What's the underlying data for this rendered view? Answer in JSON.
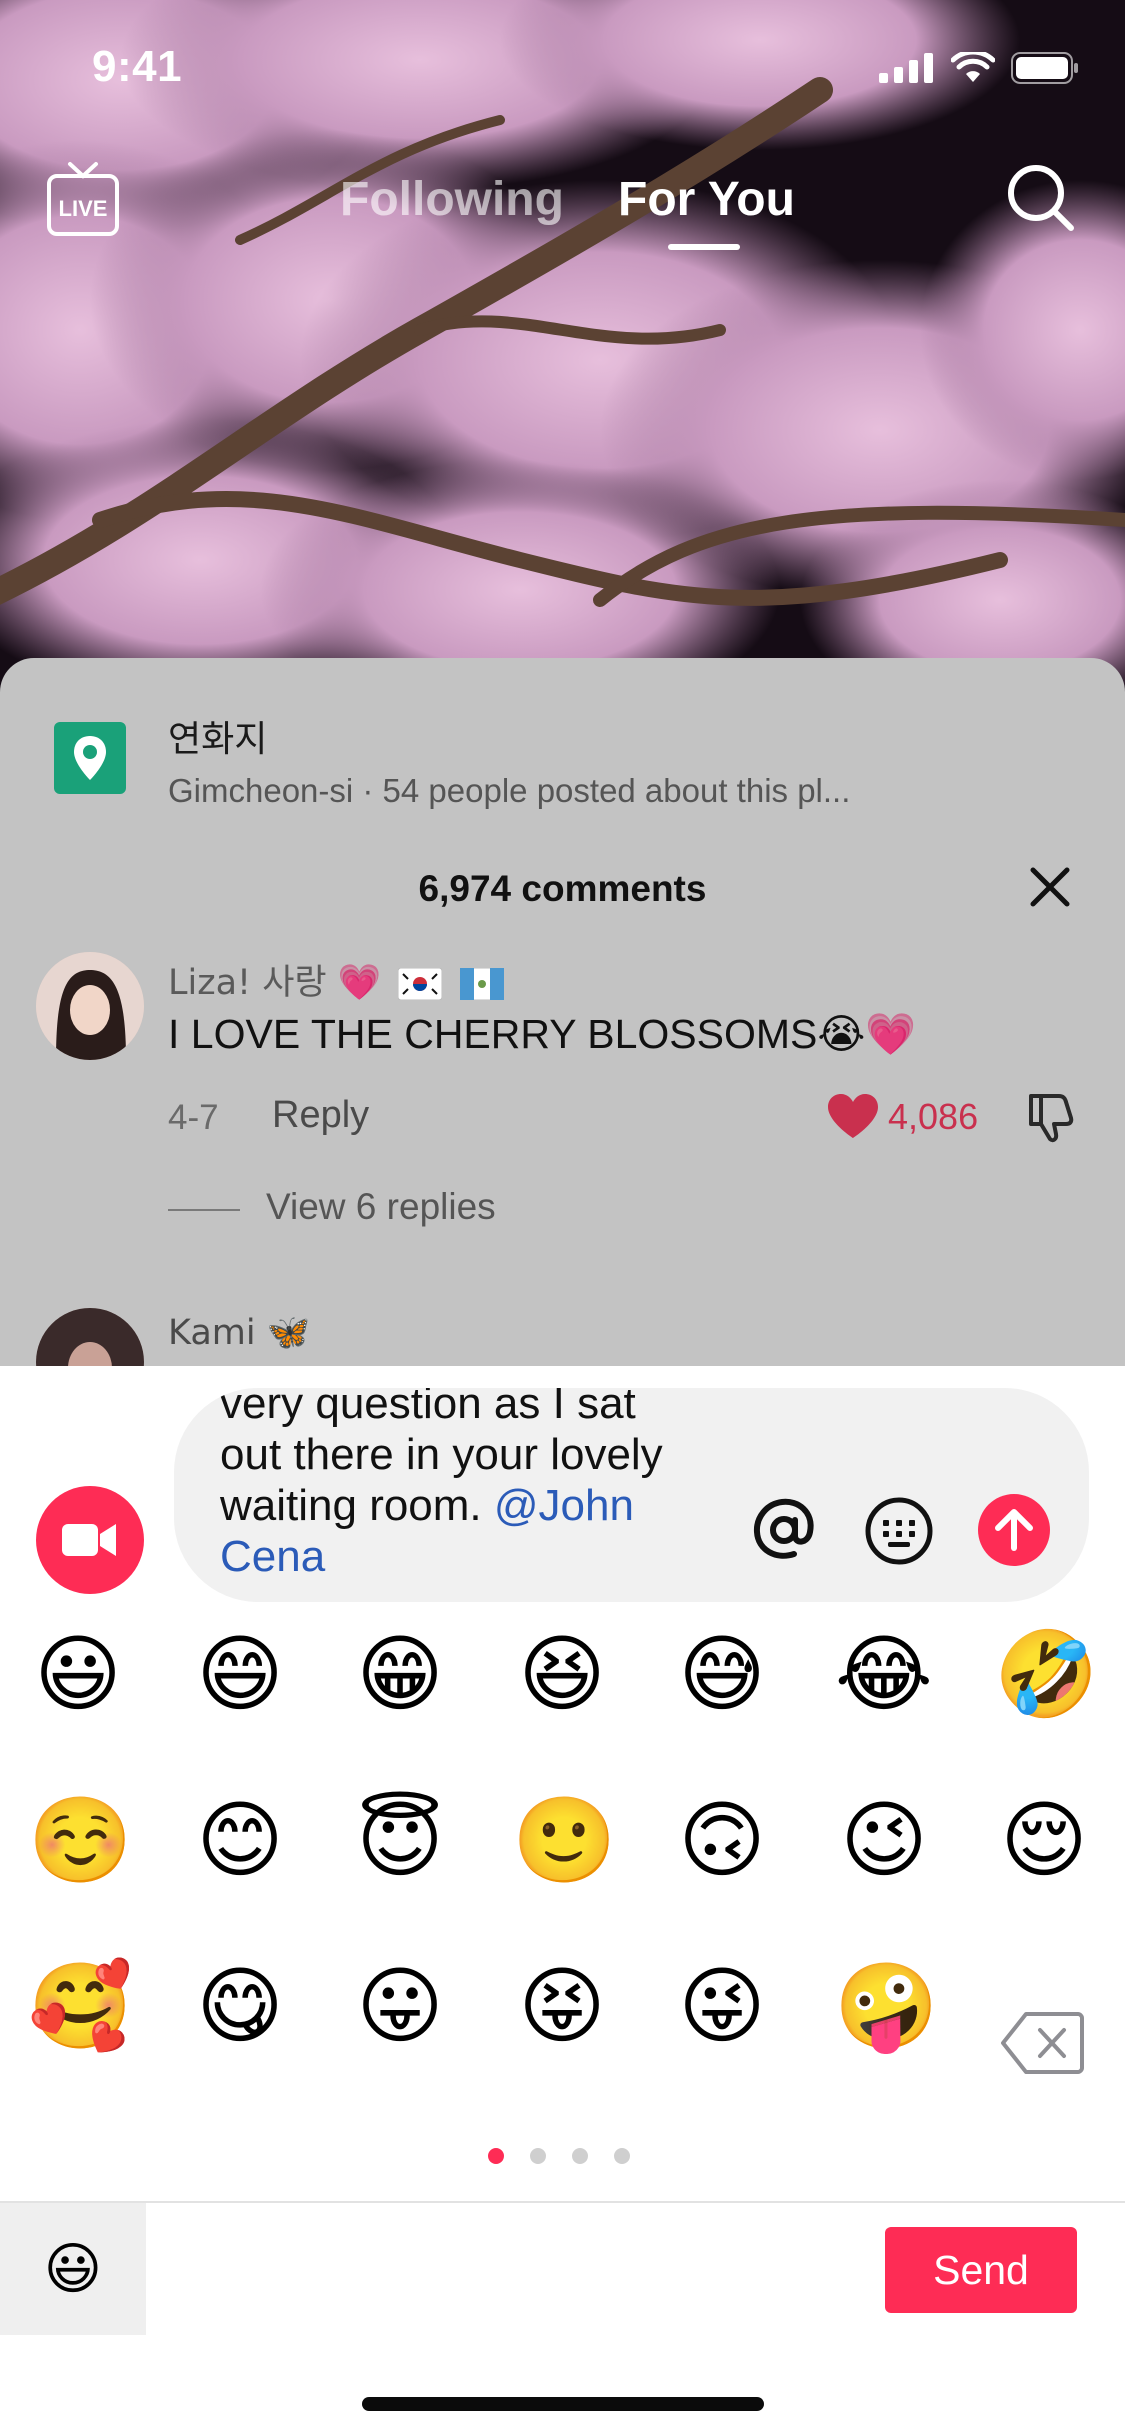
{
  "status": {
    "time": "9:41"
  },
  "nav": {
    "live_label": "LIVE",
    "tabs": [
      {
        "label": "Following",
        "active": false
      },
      {
        "label": "For You",
        "active": true
      }
    ]
  },
  "place": {
    "name": "연화지",
    "subtitle": "Gimcheon-si · 54 people posted about this pl..."
  },
  "comments": {
    "count_label": "6,974 comments",
    "items": [
      {
        "user": "Liza! 사랑 💗",
        "text": "I LOVE THE CHERRY BLOSSOMS😭💗",
        "date": "4-7",
        "reply_label": "Reply",
        "likes": "4,086",
        "view_replies": "View 6 replies"
      },
      {
        "user": "Kami 🦋"
      }
    ]
  },
  "composer": {
    "line_partial": "very question as I sat",
    "line1": "out there in your lovely",
    "line2": "waiting room. ",
    "mention": "@John Cena"
  },
  "emoji_keyboard": {
    "rows": [
      [
        "😃",
        "😄",
        "😁",
        "😆",
        "😅",
        "😂",
        "🤣"
      ],
      [
        "☺️",
        "😊",
        "😇",
        "🙂",
        "🙃",
        "😉",
        "😌"
      ],
      [
        "🥰",
        "😋",
        "😛",
        "😝",
        "😜",
        "🤪"
      ]
    ],
    "pages": 4,
    "active_page": 0,
    "toggle_emoji": "😃",
    "send_label": "Send"
  },
  "colors": {
    "accent": "#fe2c55",
    "sheet_overlay": "#c3c3c3",
    "mention": "#2b5bb8",
    "pin_green": "#1aa179"
  }
}
